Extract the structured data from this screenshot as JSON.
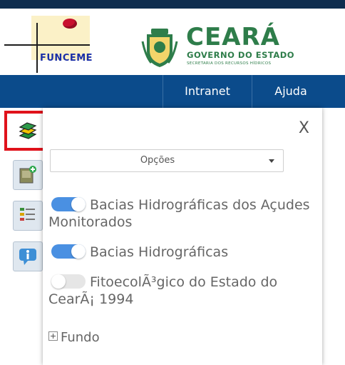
{
  "header": {
    "funceme_logo_text": "FUNCEME",
    "ceara_title": "CEARÁ",
    "ceara_subtitle": "GOVERNO DO ESTADO",
    "ceara_secretaria": "SECRETARIA DOS RECURSOS HÍDRICOS"
  },
  "nav": {
    "items": [
      {
        "label": "Intranet"
      },
      {
        "label": "Ajuda"
      }
    ]
  },
  "toolbar": {
    "tools": [
      {
        "icon": "layers-icon",
        "active": true
      },
      {
        "icon": "add-layer-icon"
      },
      {
        "icon": "legend-icon"
      },
      {
        "icon": "info-icon"
      }
    ]
  },
  "panel": {
    "close_label": "X",
    "select": {
      "selected": "Opções"
    },
    "layers": [
      {
        "label": "Bacias Hidrográficas dos Açudes Monitorados",
        "enabled": true
      },
      {
        "label": "Bacias Hidrográficas",
        "enabled": true
      },
      {
        "label": "FitoecolÃ³gico do Estado do CearÃ¡ 1994",
        "enabled": false
      }
    ],
    "fundo_label": "Fundo"
  },
  "colors": {
    "navbar": "#0b4b8b",
    "topbar": "#0e2d4e",
    "toggle_on": "#4a90e2",
    "highlight": "#e0121b",
    "ceara_green": "#2e7d4a"
  }
}
